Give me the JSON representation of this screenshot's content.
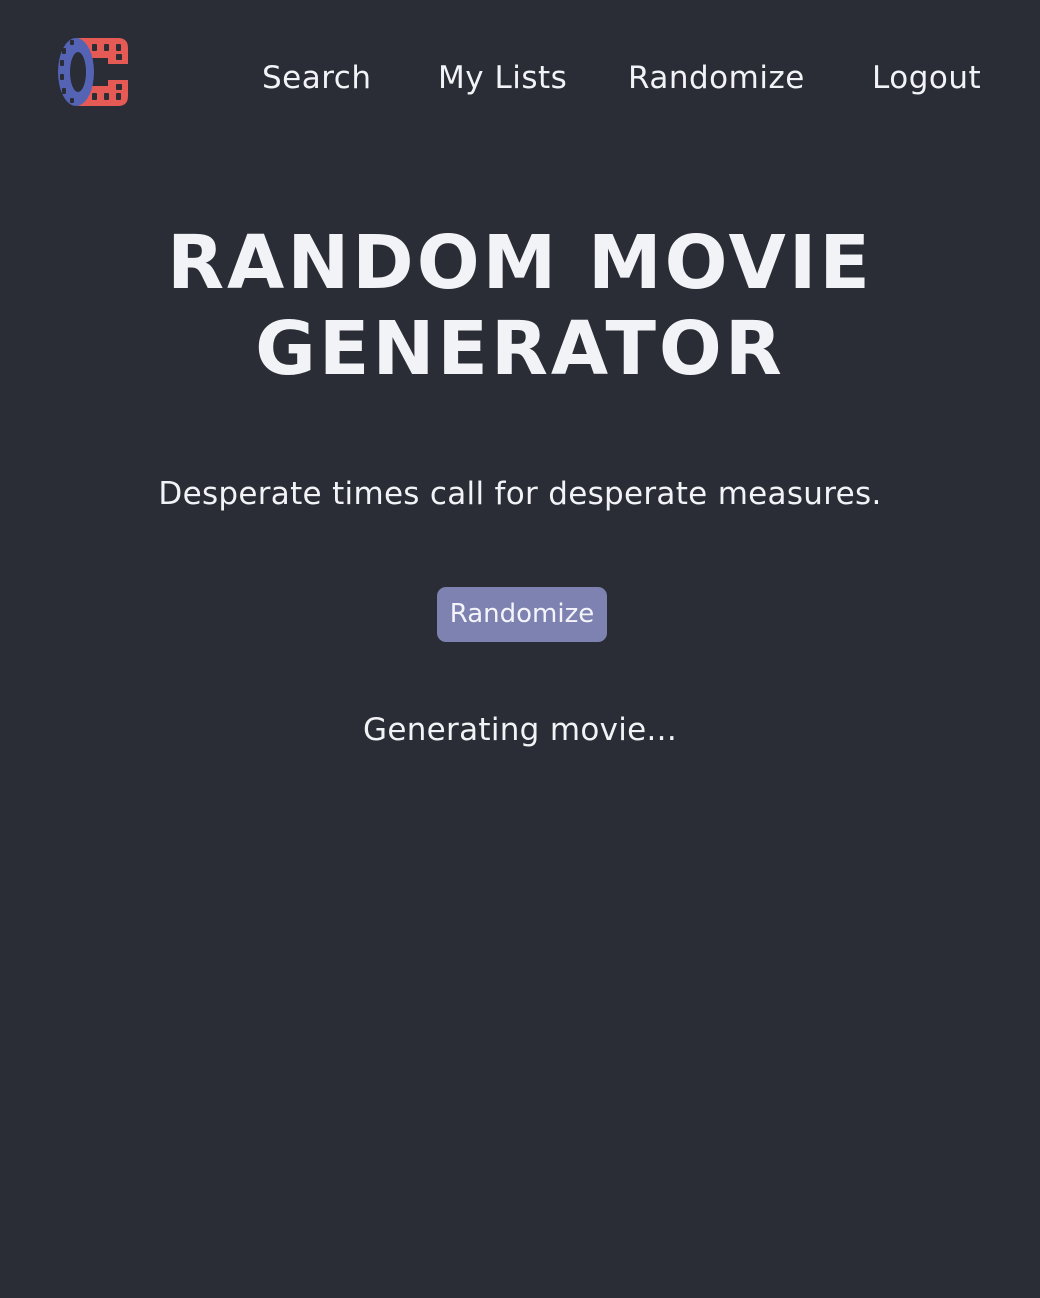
{
  "header": {
    "logo_icon": "film-reel-c-icon",
    "nav": [
      {
        "label": "Search"
      },
      {
        "label": "My Lists"
      },
      {
        "label": "Randomize"
      },
      {
        "label": "Logout"
      }
    ]
  },
  "main": {
    "title_line1": "RANDOM MOVIE",
    "title_line2": "GENERATOR",
    "subtitle": "Desperate times call for desperate measures.",
    "button_label": "Randomize",
    "status": "Generating movie..."
  },
  "colors": {
    "background": "#2a2d35",
    "text": "#f2f3f7",
    "button": "#7d82b0",
    "logo_blue": "#5563b5",
    "logo_red": "#e55a55"
  }
}
